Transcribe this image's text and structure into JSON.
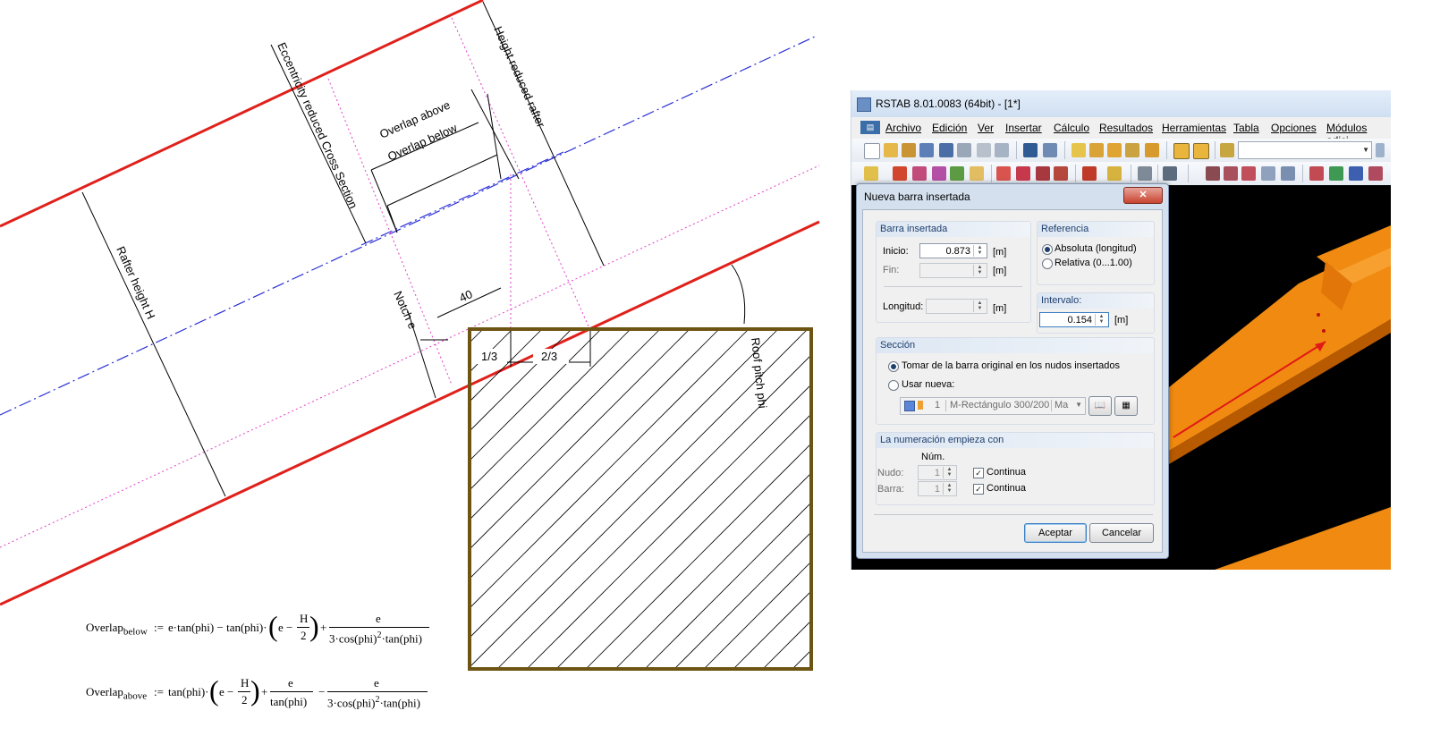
{
  "drawing": {
    "labels": {
      "height_reduced_rafter": "Height reduced rafter",
      "eccentricity_reduced": "Eccentricity reduced Cross Section",
      "overlap_above": "Overlap above",
      "overlap_below": "Overlap below",
      "rafter_height": "Rafter height H",
      "notch_e": "Notch e",
      "dim_40": "40",
      "one_third": "1/3",
      "two_thirds": "2/3",
      "roof_pitch": "Roof pitch phi"
    },
    "colors": {
      "rafter_line": "#e0201a",
      "axis_line": "#2a2fd6",
      "dotted": "#e040c8",
      "section_border": "#6e5412"
    }
  },
  "formulas": {
    "below": {
      "lhs": "Overlap",
      "sub": "below",
      "assign": ":=",
      "t1": "e·tan(phi) − tan(phi)·",
      "paren_a": "e −",
      "h_num": "H",
      "h_den": "2",
      "plus": "+",
      "f_num": "e",
      "f_den": "3·cos(phi)",
      "f_den_exp": "2",
      "f_den_tail": "·tan(phi)"
    },
    "above": {
      "lhs": "Overlap",
      "sub": "above",
      "assign": ":=",
      "t1": "tan(phi)·",
      "paren_a": "e −",
      "h_num": "H",
      "h_den": "2",
      "plus": "+",
      "m_num": "e",
      "m_den": "tan(phi)",
      "minus": "−",
      "f_num": "e",
      "f_den": "3·cos(phi)",
      "f_den_exp": "2",
      "f_den_tail": "·tan(phi)"
    }
  },
  "rstab": {
    "title": "RSTAB 8.01.0083 (64bit) - [1*]",
    "menu": [
      "Archivo",
      "Edición",
      "Ver",
      "Insertar",
      "Cálculo",
      "Resultados",
      "Herramientas",
      "Tabla",
      "Opciones",
      "Módulos adici"
    ],
    "dialog": {
      "title": "Nueva barra insertada",
      "close": "✕",
      "barra_insertada": {
        "header": "Barra insertada",
        "inicio_label": "Inicio:",
        "inicio_value": "0.873",
        "fin_label": "Fin:",
        "fin_value": "",
        "longitud_label": "Longitud:",
        "longitud_value": "",
        "unit": "[m]"
      },
      "referencia": {
        "header": "Referencia",
        "opt1": "Absoluta (longitud)",
        "opt2": "Relativa (0...1.00)"
      },
      "intervalo": {
        "header": "Intervalo:",
        "value": "0.154",
        "unit": "[m]"
      },
      "seccion": {
        "header": "Sección",
        "opt1": "Tomar de la barra original en los nudos insertados",
        "opt2": "Usar nueva:",
        "combo_num": "1",
        "combo_text": "M-Rectángulo 300/200",
        "combo_tail": "Ma"
      },
      "numeracion": {
        "header": "La numeración empieza con",
        "num_header": "Núm.",
        "nudo_label": "Nudo:",
        "nudo_value": "1",
        "barra_label": "Barra:",
        "barra_value": "1",
        "continua": "Continua"
      },
      "ok": "Aceptar",
      "cancel": "Cancelar"
    }
  }
}
